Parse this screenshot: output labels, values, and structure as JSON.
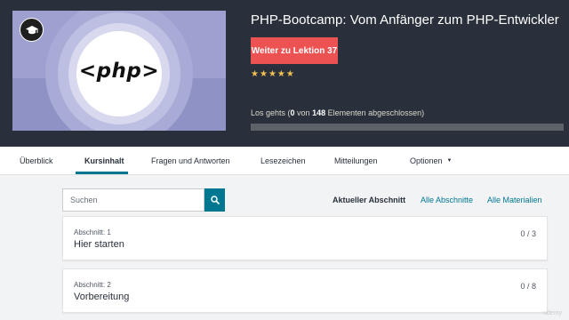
{
  "course": {
    "title": "PHP-Bootcamp: Vom Anfänger zum PHP-Entwickler",
    "continue_label": "Weiter zu Lektion 37",
    "rating": 5,
    "thumbnail_text": "<php>",
    "progress": {
      "prefix": "Los gehts (",
      "completed": "0",
      "middle": " von ",
      "total": "148",
      "suffix": " Elementen abgeschlossen)",
      "fraction": 0
    }
  },
  "tabs": {
    "overview": "Überblick",
    "content": "Kursinhalt",
    "qa": "Fragen und Antworten",
    "bookmarks": "Lesezeichen",
    "announcements": "Mitteilungen",
    "options": "Optionen"
  },
  "search": {
    "placeholder": "Suchen"
  },
  "filters": {
    "current": "Aktueller Abschnitt",
    "all_sections": "Alle Abschnitte",
    "all_materials": "Alle Materialien"
  },
  "sections": [
    {
      "label": "Abschnitt: 1",
      "title": "Hier starten",
      "count": "0 / 3"
    },
    {
      "label": "Abschnitt: 2",
      "title": "Vorbereitung",
      "count": "0 / 8"
    }
  ],
  "watermark": "udemy",
  "colors": {
    "header_bg": "#29303b",
    "accent_red": "#ec5252",
    "teal": "#007791",
    "star": "#f4c150"
  },
  "icons": {
    "thumbnail_badge": "graduation-cap-icon",
    "search": "search-icon",
    "options": "chevron-down-icon"
  }
}
